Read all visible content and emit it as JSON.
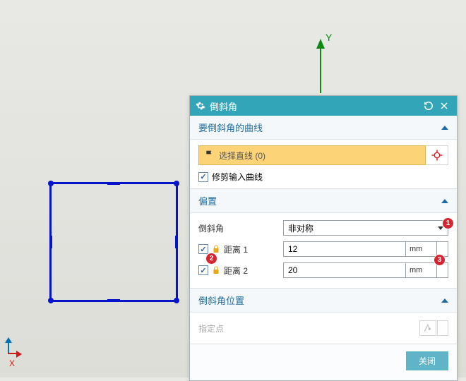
{
  "axis": {
    "y_label": "Y",
    "x_label": "X"
  },
  "dialog": {
    "title": "倒斜角",
    "section_curves": {
      "header": "要倒斜角的曲线",
      "select_label": "选择直线 (0)",
      "trim_label": "修剪输入曲线",
      "trim_checked": true
    },
    "section_offset": {
      "header": "偏置",
      "chamfer_label": "倒斜角",
      "chamfer_value": "非对称",
      "dist1_label": "距离 1",
      "dist1_value": "12",
      "dist1_unit": "mm",
      "dist1_checked": true,
      "dist2_label": "距离 2",
      "dist2_value": "20",
      "dist2_unit": "mm",
      "dist2_checked": true
    },
    "section_position": {
      "header": "倒斜角位置",
      "point_label": "指定点"
    },
    "close_label": "关闭"
  },
  "badges": {
    "b1": "1",
    "b2": "2",
    "b3": "3"
  }
}
